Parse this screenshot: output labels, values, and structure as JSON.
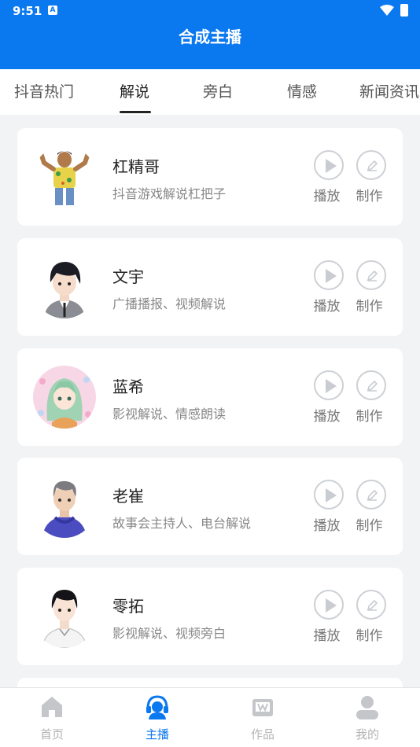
{
  "status_bar": {
    "time": "9:51",
    "notification_letter": "A"
  },
  "app_bar": {
    "title": "合成主播"
  },
  "tabs": [
    {
      "label": "抖音热门"
    },
    {
      "label": "解说"
    },
    {
      "label": "旁白"
    },
    {
      "label": "情感"
    },
    {
      "label": "新闻资讯"
    }
  ],
  "active_tab": "解说",
  "anchors": [
    {
      "name": "杠精哥",
      "desc": "抖音游戏解说杠把子",
      "play_label": "播放",
      "make_label": "制作"
    },
    {
      "name": "文宇",
      "desc": "广播播报、视频解说",
      "play_label": "播放",
      "make_label": "制作"
    },
    {
      "name": "蓝希",
      "desc": "影视解说、情感朗读",
      "play_label": "播放",
      "make_label": "制作"
    },
    {
      "name": "老崔",
      "desc": "故事会主持人、电台解说",
      "play_label": "播放",
      "make_label": "制作"
    },
    {
      "name": "零拓",
      "desc": "影视解说、视频旁白",
      "play_label": "播放",
      "make_label": "制作"
    }
  ],
  "bottom_nav": [
    {
      "label": "首页",
      "icon": "home-icon"
    },
    {
      "label": "主播",
      "icon": "headset-icon"
    },
    {
      "label": "作品",
      "icon": "works-icon"
    },
    {
      "label": "我的",
      "icon": "profile-icon"
    }
  ],
  "colors": {
    "accent": "#0a78ef",
    "inactive": "#b3b3b3",
    "background": "#f2f3f5"
  }
}
